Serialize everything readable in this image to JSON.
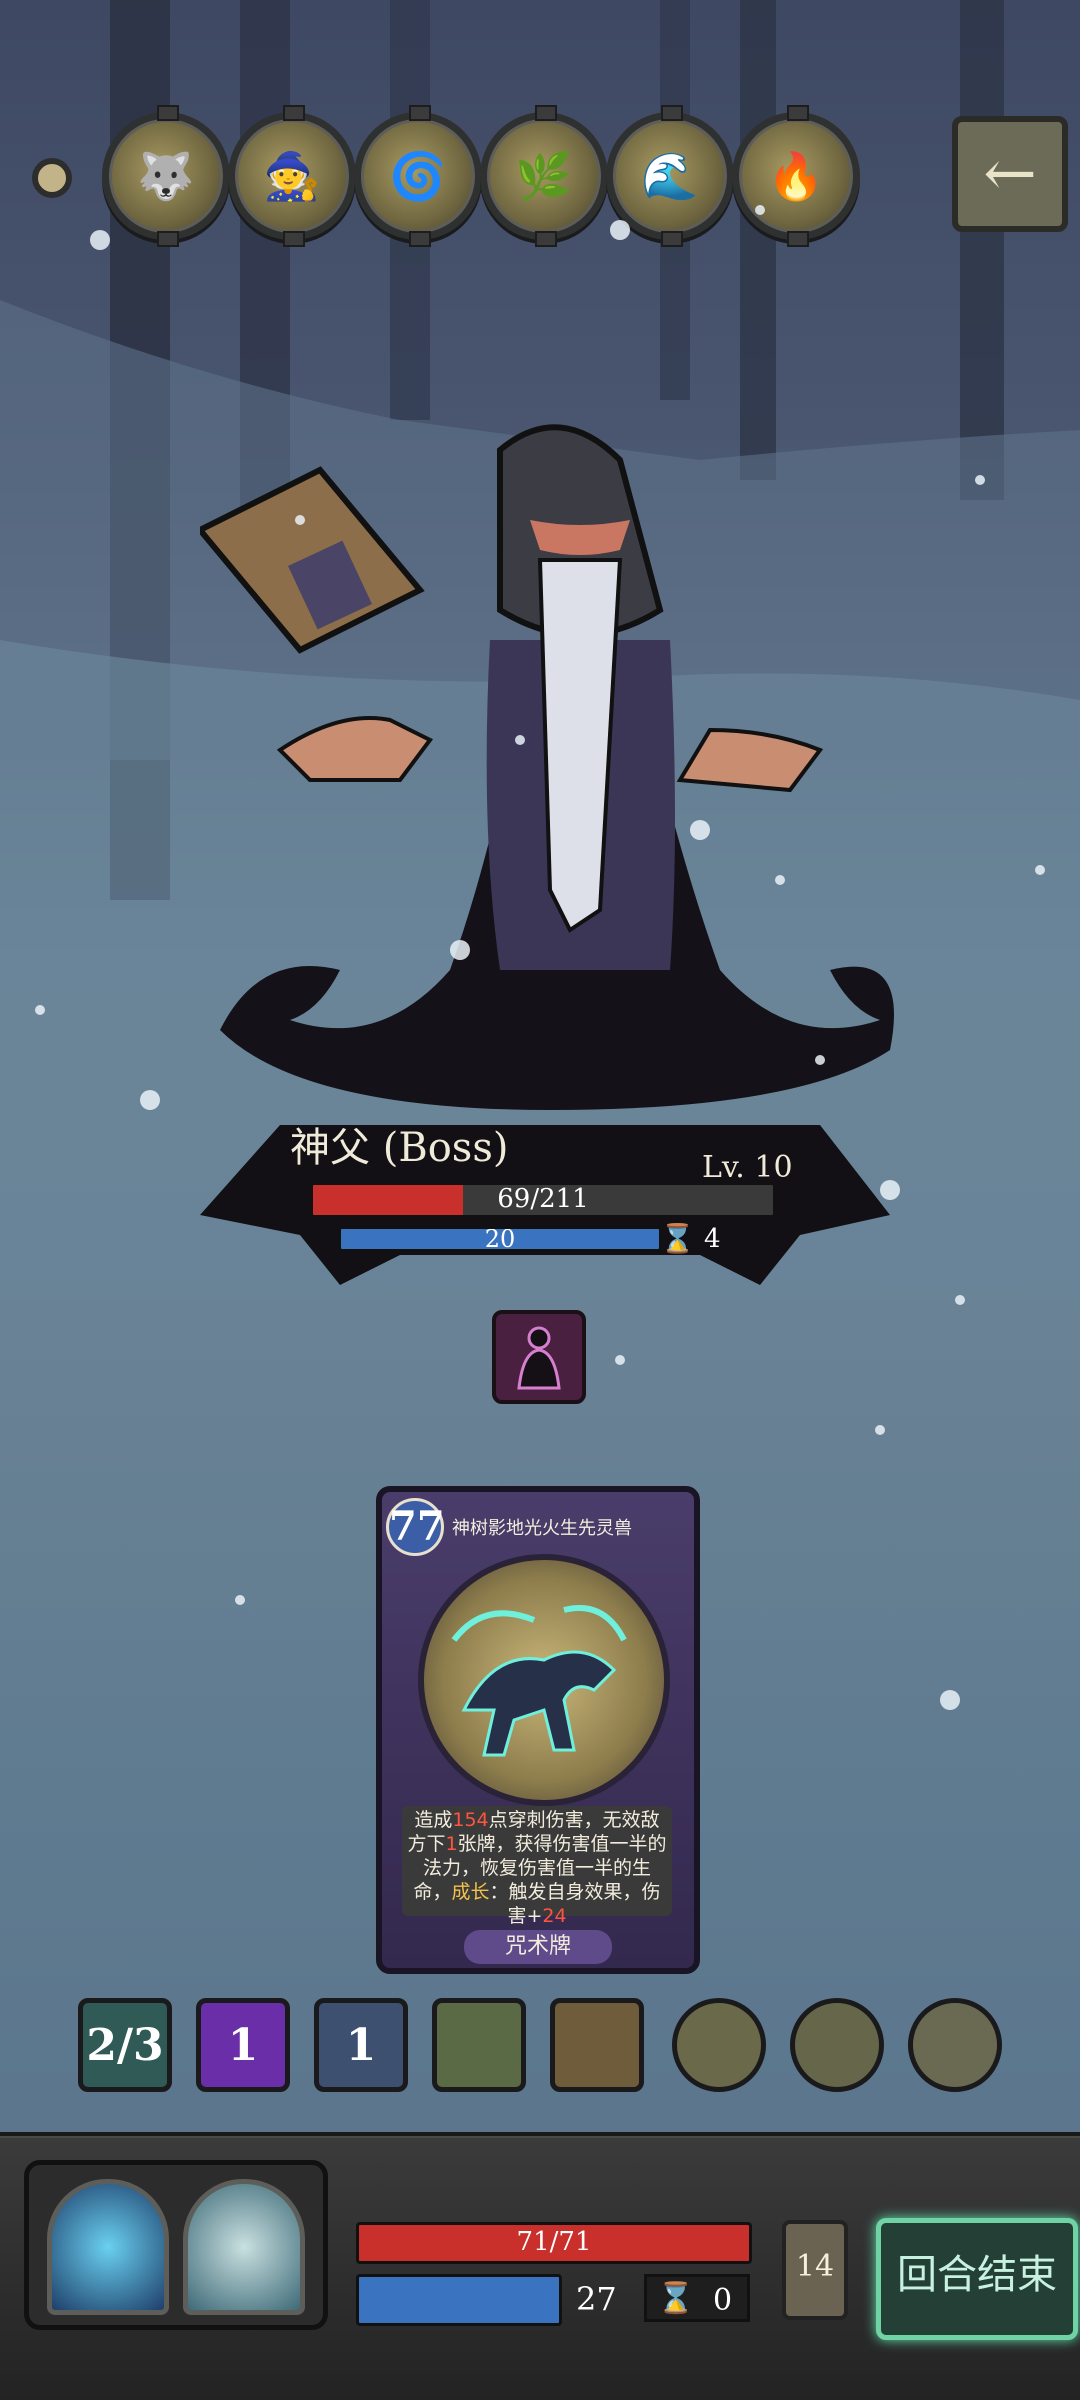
{
  "relics": [
    {
      "name": "spirit-wolf-relic",
      "glyph": "🐺"
    },
    {
      "name": "witch-relic",
      "glyph": "🧙"
    },
    {
      "name": "wind-spirit-relic",
      "glyph": "🌀"
    },
    {
      "name": "tree-branch-relic",
      "glyph": "🌿"
    },
    {
      "name": "vortex-relic",
      "glyph": "🌊"
    },
    {
      "name": "fire-relic",
      "glyph": "🔥"
    }
  ],
  "back_icon": "←",
  "boss": {
    "name": "神父 (Boss)",
    "level": "Lv. 10",
    "hp_text": "69/211",
    "hp_fraction": 0.327,
    "mana_text": "20",
    "timer": "4",
    "hourglass": "⌛"
  },
  "card": {
    "cost": "77",
    "title": "神树影地光火生先灵兽",
    "desc_parts": [
      "造成",
      "154",
      "点穿刺伤害，无效敌方下",
      "1",
      "张牌，获得伤害值一半的法力，恢复伤害值一半的生命，",
      "成长",
      "：触发自身效果，伤害+",
      "24"
    ],
    "type": "咒术牌"
  },
  "skills": [
    {
      "label": "2/3",
      "bg": "#2f5a55"
    },
    {
      "label": "1",
      "bg": "#6a2fa8"
    },
    {
      "label": "1",
      "bg": "#3d5070"
    },
    {
      "label": "",
      "bg": "#5a6a45"
    },
    {
      "label": "",
      "bg": "#6e5c3b"
    },
    {
      "label": "",
      "bg": "#6a6a4a"
    },
    {
      "label": "",
      "bg": "#66664a"
    },
    {
      "label": "",
      "bg": "#6a6a52"
    }
  ],
  "player": {
    "hp_text": "71/71",
    "hp_fraction": 1.0,
    "mana": "27",
    "timer": "0",
    "deck_count": "14"
  },
  "end_turn_label": "回合结束",
  "colors": {
    "accent": "#6fd3a4",
    "hp": "#c9302c",
    "mana": "#3a73c0"
  }
}
